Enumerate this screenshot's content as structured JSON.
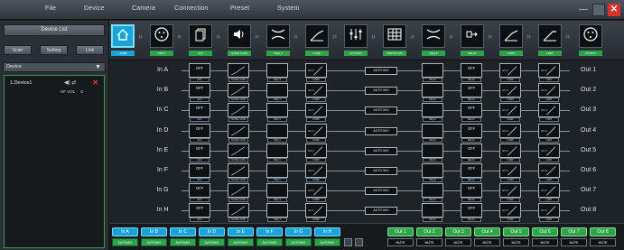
{
  "menu": [
    "File",
    "Device",
    "Camera",
    "Connection",
    "Preset",
    "System"
  ],
  "window_controls": {
    "minimize": "—",
    "close": "✕"
  },
  "left": {
    "device_list_label": "Device List",
    "buttons": [
      "Scan",
      "Setting",
      "Link"
    ],
    "device_dropdown": "Device",
    "device": {
      "name": "1.Device1",
      "version_label": "HF VOL",
      "version_value": "0"
    }
  },
  "modules": [
    {
      "icon": "home-icon",
      "label": "HOME",
      "active": true
    },
    {
      "icon": "xlr-icon",
      "label": "INPUT"
    },
    {
      "icon": "copy-icon",
      "label": "AFC"
    },
    {
      "icon": "speaker-icon",
      "label": "NOISE GATE"
    },
    {
      "icon": "filter-icon",
      "label": "PEQ 4"
    },
    {
      "icon": "compressor-icon",
      "label": "COMP"
    },
    {
      "icon": "faders-icon",
      "label": "AUTOMIX"
    },
    {
      "icon": "matrix-icon",
      "label": "MATRIX MIX"
    },
    {
      "icon": "filter-icon",
      "label": "PEQ 8"
    },
    {
      "icon": "delay-icon",
      "label": "DELAY"
    },
    {
      "icon": "compressor-icon",
      "label": "COMP"
    },
    {
      "icon": "limiter-icon",
      "label": "LIMIT"
    },
    {
      "icon": "xlr-icon",
      "label": "OUTPUT"
    }
  ],
  "inputs": [
    "In A",
    "In B",
    "In C",
    "In D",
    "In E",
    "In F",
    "In G",
    "In H"
  ],
  "outputs": [
    "Out 1",
    "Out 2",
    "Out 3",
    "Out 4",
    "Out 5",
    "Out 6",
    "Out 7",
    "Out 8"
  ],
  "cell_text": {
    "afc_value": "OFF",
    "afc_sub": "AFC",
    "gate_sub": "NOISE GATE",
    "peq4_sub": "PEQ 4",
    "comp_value": "0/1.0",
    "comp_sub": "COMP",
    "automix": "AUTO MIX",
    "peq8_sub": "PEQ 8",
    "delay_value": "OFF",
    "delay_sub": "DELAY",
    "comp2_value": "0/1.0",
    "comp2_sub": "COMP",
    "limit_value": "0/1.0",
    "limit_sub": "LIMIT"
  },
  "channel_bar": {
    "inputs": [
      "In A",
      "In B",
      "In C",
      "In D",
      "In E",
      "In F",
      "In G",
      "In H"
    ],
    "outputs": [
      "Out 1",
      "Out 2",
      "Out 3",
      "Out 4",
      "Out 5",
      "Out 6",
      "Out 7",
      "Out 8"
    ],
    "in_sub": "AUTOMIX",
    "out_sub": "MUTE"
  },
  "colors": {
    "accent_blue": "#1aa3d7",
    "accent_green": "#2fa349",
    "close_red": "#d8332a"
  }
}
